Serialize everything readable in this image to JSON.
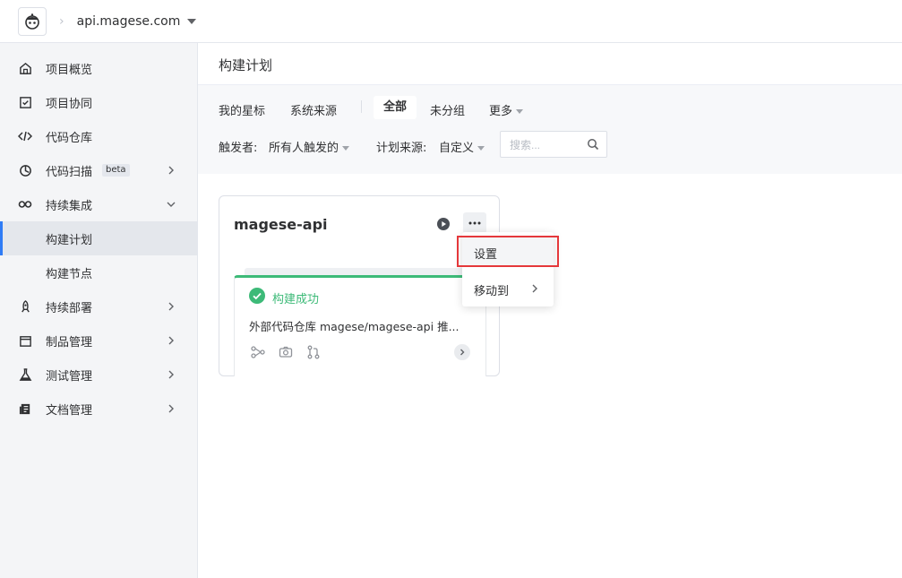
{
  "header": {
    "project_name": "api.magese.com",
    "breadcrumb_separator": "›"
  },
  "sidebar": {
    "items": [
      {
        "label": "项目概览",
        "icon": "home-icon"
      },
      {
        "label": "项目协同",
        "icon": "checkbox-icon"
      },
      {
        "label": "代码仓库",
        "icon": "code-icon"
      },
      {
        "label": "代码扫描",
        "icon": "scan-icon",
        "badge": "beta"
      },
      {
        "label": "持续集成",
        "icon": "infinity-icon"
      },
      {
        "label": "构建计划",
        "sub": true,
        "active": true
      },
      {
        "label": "构建节点",
        "sub": true
      },
      {
        "label": "持续部署",
        "icon": "rocket-icon"
      },
      {
        "label": "制品管理",
        "icon": "package-icon"
      },
      {
        "label": "测试管理",
        "icon": "flask-icon"
      },
      {
        "label": "文档管理",
        "icon": "document-icon"
      }
    ]
  },
  "main": {
    "title": "构建计划",
    "tabs": [
      {
        "label": "我的星标"
      },
      {
        "label": "系统来源"
      },
      {
        "label": "全部",
        "active": true
      },
      {
        "label": "未分组"
      },
      {
        "label": "更多"
      }
    ],
    "filters": {
      "trigger_label": "触发者:",
      "trigger_value": "所有人触发的",
      "source_label": "计划来源:",
      "source_value": "自定义",
      "search_placeholder": "搜索..."
    }
  },
  "card": {
    "title": "magese-api",
    "status": "构建成功",
    "description": "外部代码仓库 magese/magese-api 推..."
  },
  "dropdown": {
    "items": [
      {
        "label": "设置"
      },
      {
        "label": "移动到"
      }
    ]
  },
  "colors": {
    "accent": "#2f7cf6",
    "success": "#3dba78",
    "highlight": "#e5383b",
    "sidebar_bg": "#f4f5f7"
  }
}
